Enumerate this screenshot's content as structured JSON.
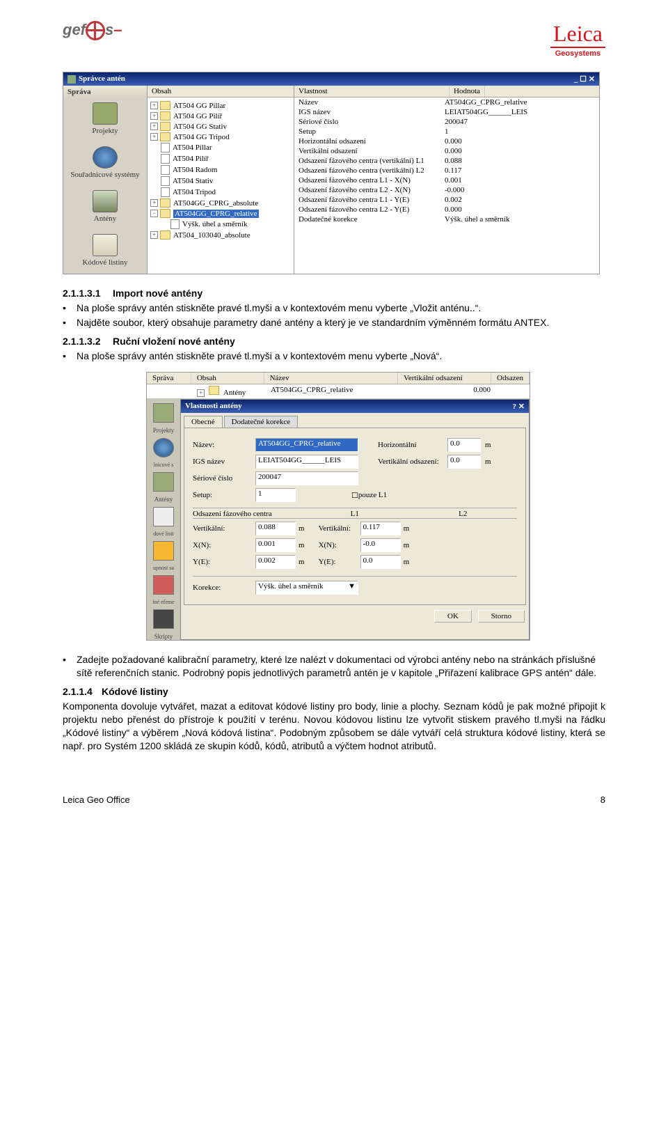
{
  "header": {
    "gefos": "gef",
    "gefos2": "s",
    "leica": "Leica",
    "leica_sub": "Geosystems"
  },
  "s1": {
    "title": "Správce antén",
    "sidebar": {
      "title": "Správa",
      "items": [
        "Projekty",
        "Souřadnicové systémy",
        "Antény",
        "Kódové listiny"
      ]
    },
    "tree_head": "Obsah",
    "tree": [
      "AT504 GG Pillar",
      "AT504 GG Pilíř",
      "AT504 GG Stativ",
      "AT504 GG Tripod",
      "AT504 Pillar",
      "AT504 Pilíř",
      "AT504 Radom",
      "AT504 Stativ",
      "AT504 Tripod",
      "AT504GG_CPRG_absolute",
      "AT504GG_CPRG_relative",
      "Výšk. úhel a směrník",
      "AT504_103040_absolute"
    ],
    "prop_head": [
      "Vlastnost",
      "Hodnota"
    ],
    "props": [
      [
        "Název",
        "AT504GG_CPRG_relative"
      ],
      [
        "IGS název",
        "LEIAT504GG______LEIS"
      ],
      [
        "Sériové číslo",
        "200047"
      ],
      [
        "Setup",
        "1"
      ],
      [
        "Horizontální odsazení",
        "0.000"
      ],
      [
        "Vertikální odsazení",
        "0.000"
      ],
      [
        "Odsazení fázového centra (vertikální) L1",
        "0.088"
      ],
      [
        "Odsazení fázového centra (vertikální) L2",
        "0.117"
      ],
      [
        "Odsazení fázového centra L1 - X(N)",
        "0.001"
      ],
      [
        "Odsazení fázového centra L2 - X(N)",
        "-0.000"
      ],
      [
        "Odsazení fázového centra L1 - Y(E)",
        "0.002"
      ],
      [
        "Odsazení fázového centra L2 - Y(E)",
        "0.000"
      ],
      [
        "Dodatečné korekce",
        "Výšk. úhel a směrník"
      ]
    ]
  },
  "sec1": {
    "h": "2.1.1.3.1",
    "t": "Import nové antény",
    "b1": "Na ploše správy antén stiskněte pravé tl.myši a v kontextovém menu vyberte „Vložit anténu..“.",
    "b2": "Najděte soubor, který obsahuje parametry dané antény a který je ve standardním výměnném formátu ANTEX."
  },
  "sec2": {
    "h": "2.1.1.3.2",
    "t": "Ruční vložení nové antény",
    "b1": "Na ploše správy antén stiskněte pravé tl.myši a v kontextovém menu vyberte „Nová“."
  },
  "s2": {
    "top": [
      "Správa",
      "Obsah",
      "Název",
      "Vertikální odsazení",
      "Odsazen"
    ],
    "row2": [
      "",
      "Antény",
      "AT504GG_CPRG_relative",
      "0.000"
    ],
    "dlg_title": "Vlastnosti antény",
    "tab1": "Obecné",
    "tab2": "Dodatečné korekce",
    "nazev_l": "Název:",
    "nazev_v": "AT504GG_CPRG_relative",
    "igs_l": "IGS název",
    "igs_v": "LEIAT504GG______LEIS",
    "ser_l": "Sériové číslo",
    "ser_v": "200047",
    "setup_l": "Setup:",
    "setup_v": "1",
    "pouze": "pouze L1",
    "horiz_l": "Horizontální",
    "horiz_v": "0.0",
    "m": "m",
    "vert_l": "Vertikální odsazení:",
    "vert_v": "0.0",
    "grp": "Odsazení fázového centra",
    "grp_l1": "L1",
    "grp_l2": "L2",
    "vk_l": "Vertikální:",
    "vk1": "0.088",
    "vk2": "0.117",
    "xn_l": "X(N):",
    "xn1": "0.001",
    "xn2": "-0.0",
    "ye_l": "Y(E):",
    "ye1": "0.002",
    "ye2": "0.0",
    "kor_l": "Korekce:",
    "kor_v": "Výšk. úhel a směrník",
    "ok": "OK",
    "storno": "Storno"
  },
  "sec3": {
    "b1": "Zadejte požadované kalibrační parametry, které lze nalézt v dokumentaci od výrobci antény nebo na stránkách příslušné sítě referenčních stanic. Podrobný popis jednotlivých parametrů antén je v kapitole „Přiřazení kalibrace GPS antén“ dále."
  },
  "sec4": {
    "h": "2.1.1.4",
    "t": "Kódové listiny",
    "body": "Komponenta dovoluje vytvářet, mazat a editovat kódové listiny pro body, linie a plochy. Seznam kódů je pak možné připojit k projektu nebo přenést do přístroje k použití v terénu. Novou kódovou listinu lze vytvořit stiskem pravého tl.myši na řádku „Kódové listiny“ a výběrem „Nová kódová listina“. Podobným způsobem se dále vytváří celá struktura kódové listiny, která se např. pro Systém 1200 skládá ze skupin kódů, kódů, atributů a výčtem hodnot atributů."
  },
  "footer": {
    "l": "Leica Geo Office",
    "r": "8"
  }
}
